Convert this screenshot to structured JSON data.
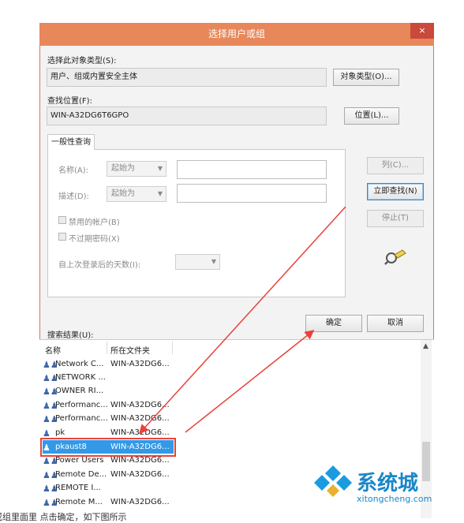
{
  "dialog": {
    "title": "选择用户或组",
    "close_glyph": "×"
  },
  "object_type": {
    "label": "选择此对象类型(S):",
    "value": "用户、组或内置安全主体",
    "button": "对象类型(O)..."
  },
  "location": {
    "label": "查找位置(F):",
    "value": "WIN-A32DG6T6GPO",
    "button": "位置(L)..."
  },
  "query": {
    "tab_label": "一般性查询",
    "name_label": "名称(A):",
    "name_mode": "起始为",
    "desc_label": "描述(D):",
    "desc_mode": "起始为",
    "disabled_accounts": "禁用的帐户(B)",
    "non_expiring_pw": "不过期密码(X)",
    "days_since_login": "自上次登录后的天数(I):"
  },
  "side_buttons": {
    "columns": "列(C)...",
    "find_now": "立即查找(N)",
    "stop": "停止(T)"
  },
  "actions": {
    "ok": "确定",
    "cancel": "取消"
  },
  "results": {
    "label": "搜索结果(U):",
    "columns": [
      "名称",
      "所在文件夹"
    ],
    "rows": [
      {
        "name": "Network C...",
        "folder": "WIN-A32DG6...",
        "icon": "group-icon"
      },
      {
        "name": "NETWORK ...",
        "folder": "",
        "icon": "group-icon"
      },
      {
        "name": "OWNER RI...",
        "folder": "",
        "icon": "group-icon"
      },
      {
        "name": "Performanc...",
        "folder": "WIN-A32DG6...",
        "icon": "group-icon"
      },
      {
        "name": "Performanc...",
        "folder": "WIN-A32DG6...",
        "icon": "group-icon"
      },
      {
        "name": "pk",
        "folder": "WIN-A32DG6...",
        "icon": "user-icon"
      },
      {
        "name": "pkaust8",
        "folder": "WIN-A32DG6...",
        "icon": "user-icon",
        "selected": true
      },
      {
        "name": "Power Users",
        "folder": "WIN-A32DG6...",
        "icon": "group-icon"
      },
      {
        "name": "Remote De...",
        "folder": "WIN-A32DG6...",
        "icon": "group-icon"
      },
      {
        "name": "REMOTE I...",
        "folder": "",
        "icon": "group-icon"
      },
      {
        "name": "Remote M...",
        "folder": "WIN-A32DG6...",
        "icon": "group-icon"
      }
    ]
  },
  "caption_fragment": "或组里面里 点击确定，如下图所示",
  "watermark": {
    "brand": "系统城",
    "url": "xitongcheng.com"
  },
  "colors": {
    "accent": "#e8875a",
    "selection": "#3399e6",
    "arrow": "#e8433a"
  }
}
